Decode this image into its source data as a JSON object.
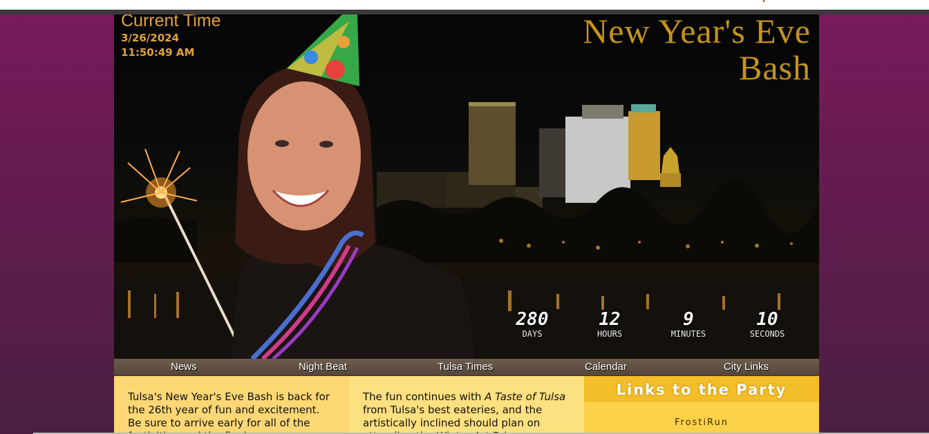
{
  "clock": {
    "label": "Current Time",
    "date": "3/26/2024",
    "time": "11:50:49 AM"
  },
  "header": {
    "title": "New Year's Eve Bash"
  },
  "countdown": {
    "days": {
      "value": "280",
      "unit": "DAYS"
    },
    "hours": {
      "value": "12",
      "unit": "HOURS"
    },
    "minutes": {
      "value": "9",
      "unit": "MINUTES"
    },
    "seconds": {
      "value": "10",
      "unit": "SECONDS"
    }
  },
  "nav": {
    "items": [
      "News",
      "Night Beat",
      "Tulsa Times",
      "Calendar",
      "City Links"
    ]
  },
  "content": {
    "col1_text": "Tulsa's New Year's Eve Bash is back for the 26th year of fun and excitement. Be sure to arrive early for all of the festivities and the final",
    "col2_pre": "The fun continues with ",
    "col2_em": "A Taste of Tulsa",
    "col2_post": " from Tulsa's best eateries, and the artistically inclined should plan on attending the Winter Art Fair"
  },
  "links": {
    "heading": "Links to the Party",
    "items": [
      "FrostiRun"
    ]
  },
  "colors": {
    "background": "#6e1b55",
    "title_gold": "#c69418",
    "clock_orange": "#e0a23a",
    "col1_bg": "#fcd774",
    "col2_bg": "#fde07f",
    "col3_bg": "#fcd14a",
    "links_head_bg": "#f3be2a"
  }
}
